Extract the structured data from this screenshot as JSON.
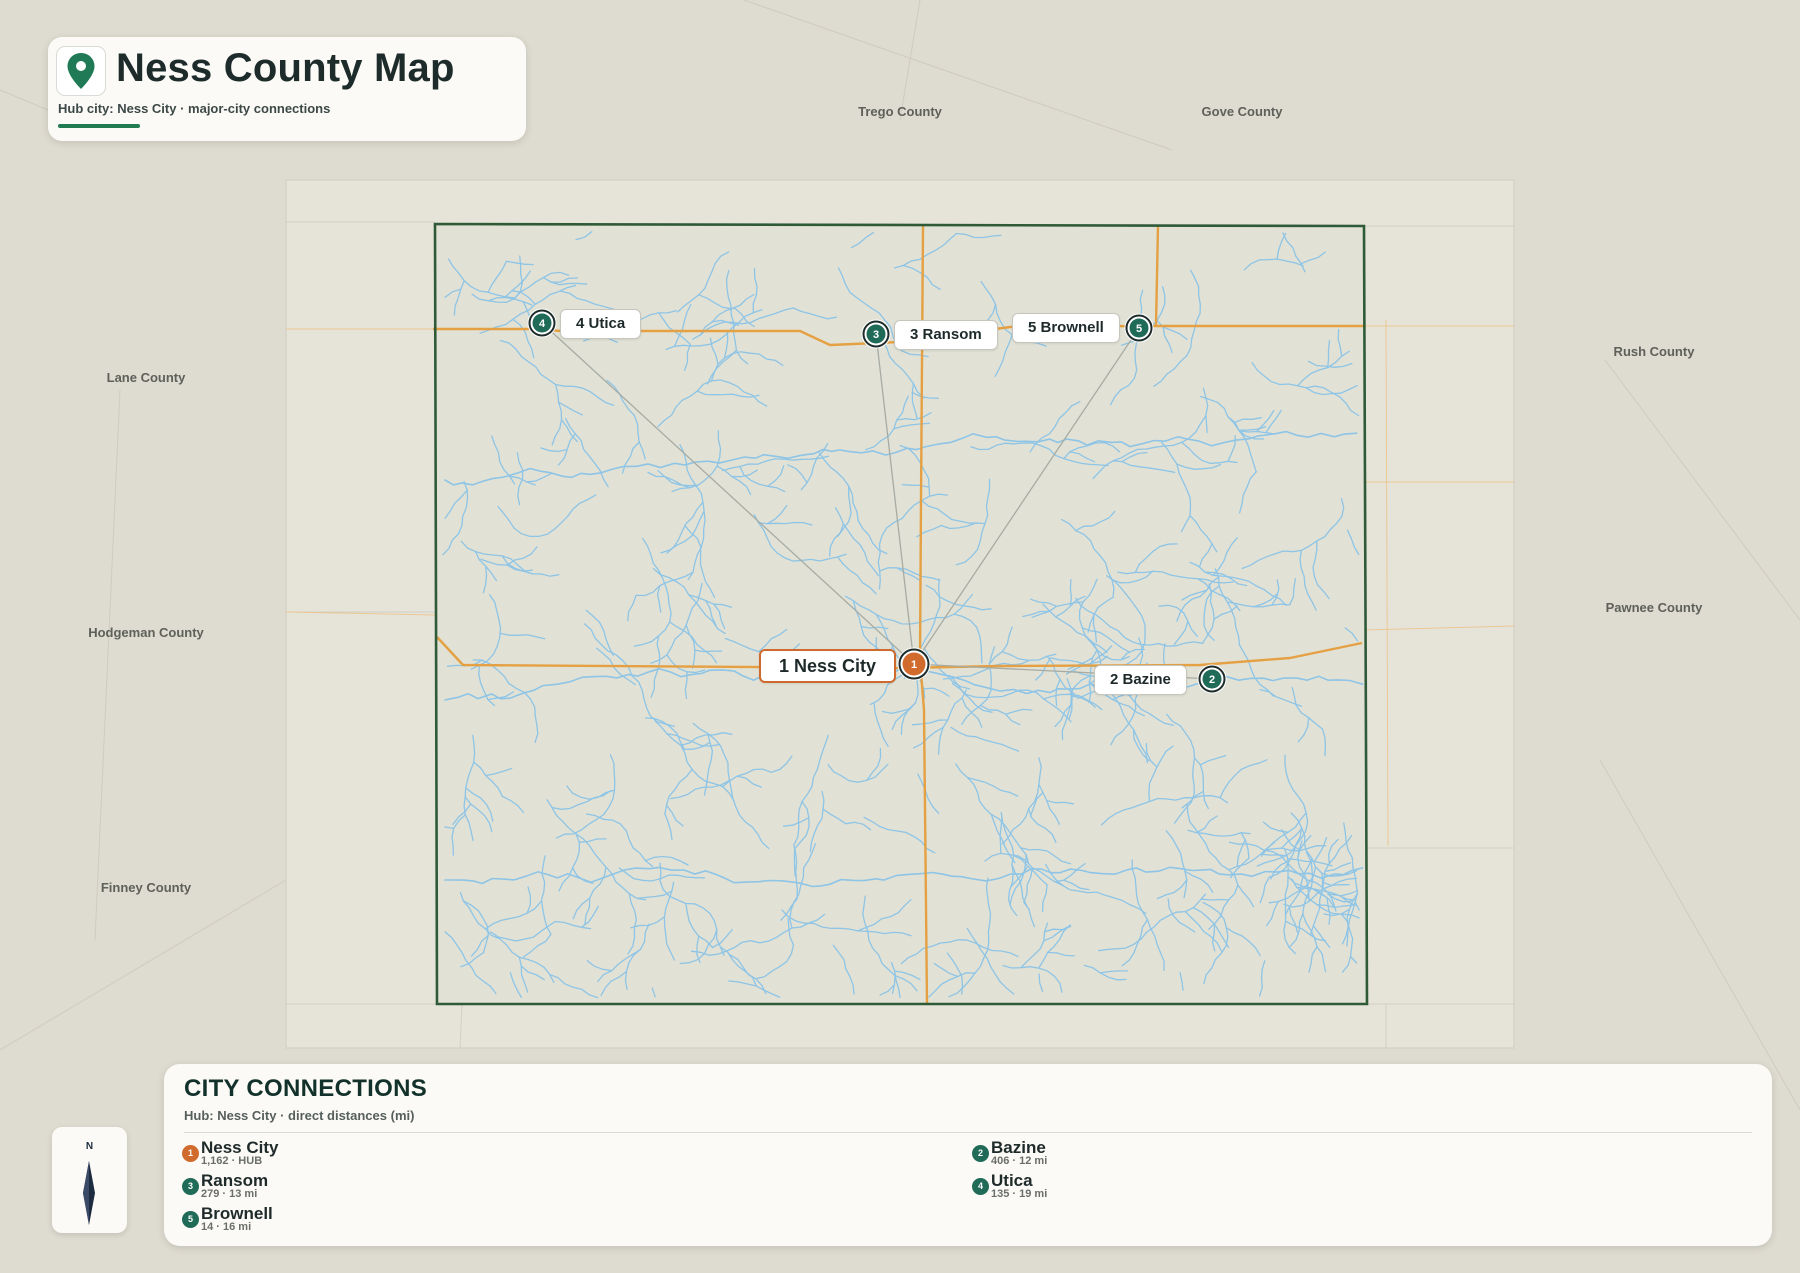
{
  "header": {
    "title": "Ness County Map",
    "subtitle": "Hub city: Ness City · major-city connections"
  },
  "neighbors": [
    {
      "id": "trego",
      "name": "Trego County"
    },
    {
      "id": "gove",
      "name": "Gove County"
    },
    {
      "id": "lane",
      "name": "Lane County"
    },
    {
      "id": "rush",
      "name": "Rush County"
    },
    {
      "id": "pawnee",
      "name": "Pawnee County"
    },
    {
      "id": "hodgeman",
      "name": "Hodgeman County"
    },
    {
      "id": "finney",
      "name": "Finney County"
    }
  ],
  "cities": [
    {
      "rank": "1",
      "name": "Ness City",
      "label": "1 Ness City",
      "detail": "1,162 · HUB",
      "hub": true
    },
    {
      "rank": "2",
      "name": "Bazine",
      "label": "2 Bazine",
      "detail": "406 · 12 mi",
      "hub": false
    },
    {
      "rank": "3",
      "name": "Ransom",
      "label": "3 Ransom",
      "detail": "279 · 13 mi",
      "hub": false
    },
    {
      "rank": "4",
      "name": "Utica",
      "label": "4 Utica",
      "detail": "135 · 19 mi",
      "hub": false
    },
    {
      "rank": "5",
      "name": "Brownell",
      "label": "5 Brownell",
      "detail": "14 · 16 mi",
      "hub": false
    }
  ],
  "legend": {
    "title": "CITY CONNECTIONS",
    "subtitle": "Hub: Ness City · direct distances (mi)"
  },
  "compass": {
    "north_label": "N"
  },
  "colors": {
    "hub": "#d06b2d",
    "city": "#1f6b58",
    "county_border": "#2f5a38",
    "highway": "#e4a043",
    "river": "#8ec4e6"
  }
}
